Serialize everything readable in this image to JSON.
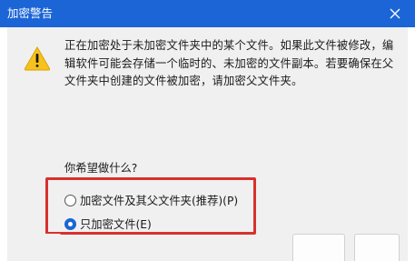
{
  "window": {
    "title": "加密警告"
  },
  "icons": {
    "close": "close-icon",
    "warning": "warning-icon"
  },
  "colors": {
    "titlebar": "#1b65d6",
    "highlight": "#d9302c",
    "warning_yellow": "#f7c21c"
  },
  "message": {
    "text": "正在加密处于未加密文件夹中的某个文件。如果此文件被修改，编辑软件可能会存储一个临时的、未加密的文件副本。若要确保在父文件夹中创建的文件被加密，请加密父文件夹。"
  },
  "question": {
    "text": "你希望做什么?"
  },
  "options": [
    {
      "label": "加密文件及其父文件夹(推荐)(P)",
      "checked": false
    },
    {
      "label": "只加密文件(E)",
      "checked": true
    }
  ]
}
